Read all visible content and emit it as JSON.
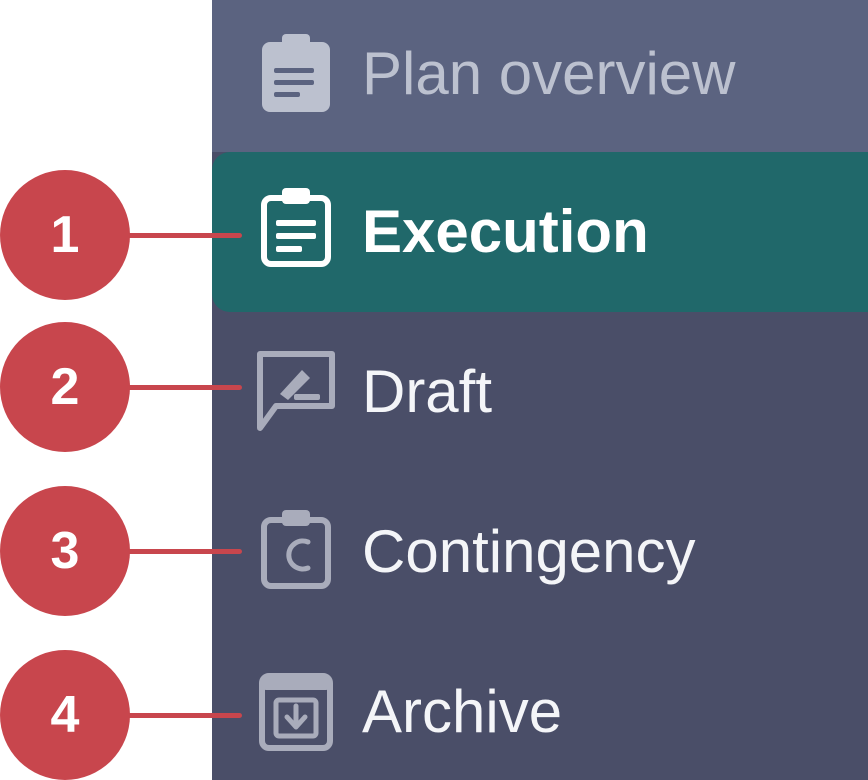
{
  "header": {
    "title": "Plan overview",
    "icon": "clipboard-icon"
  },
  "nav": {
    "items": [
      {
        "label": "Execution",
        "icon": "clipboard-list-icon",
        "active": true
      },
      {
        "label": "Draft",
        "icon": "draft-comment-icon",
        "active": false
      },
      {
        "label": "Contingency",
        "icon": "clipboard-c-icon",
        "active": false
      },
      {
        "label": "Archive",
        "icon": "archive-icon",
        "active": false
      }
    ]
  },
  "callouts": [
    "1",
    "2",
    "3",
    "4"
  ],
  "colors": {
    "sidebar_bg": "#4a4e68",
    "header_bg": "#5b6380",
    "active_bg": "#20686a",
    "callout": "#c8464d",
    "inactive_icon": "#a9acbb"
  }
}
